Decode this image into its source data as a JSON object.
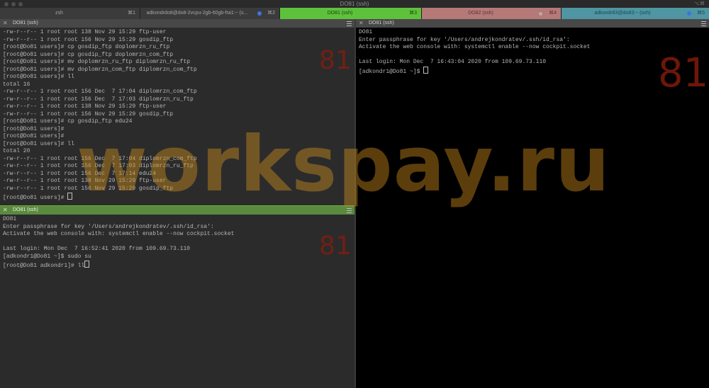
{
  "window": {
    "title": "DO81 (ssh)",
    "shortcut_hint": "⌥⌘"
  },
  "tabs": [
    {
      "label": "zsh",
      "shortcut": "⌘1",
      "color": "#3b3b3b"
    },
    {
      "label": "adkondrdo8@do8-2vcpu-2gb-60gb-fra1:~ (s...",
      "shortcut": "⌘2",
      "color": "#3b3b3b"
    },
    {
      "label": "DO81 (ssh)",
      "shortcut": "⌘3",
      "color": "#5ec13b"
    },
    {
      "label": "DO82 (ssh)",
      "shortcut": "⌘4",
      "color": "#b57a78"
    },
    {
      "label": "adkondr83@do83:~ (ssh)",
      "shortcut": "⌘5",
      "color": "#4f95a3"
    }
  ],
  "panes": {
    "top_left": {
      "title": "DO81 (ssh)",
      "number": "81",
      "lines": [
        "-rw-r--r-- 1 root root 138 Nov 29 15:29 ftp-user",
        "-rw-r--r-- 1 root root 156 Nov 29 15:29 gosdip_ftp",
        "[root@Do81 users]# cp gosdip_ftp doplomrzn_ru_ftp",
        "[root@Do81 users]# cp gosdip_ftp doplomrzn_com_ftp",
        "[root@Do81 users]# mv doplomrzn_ru_ftp diplomrzn_ru_ftp",
        "[root@Do81 users]# mv doplomrzn_com_ftp diplomrzn_com_ftp",
        "[root@Do81 users]# ll",
        "total 16",
        "-rw-r--r-- 1 root root 156 Dec  7 17:04 diplomrzn_com_ftp",
        "-rw-r--r-- 1 root root 156 Dec  7 17:03 diplomrzn_ru_ftp",
        "-rw-r--r-- 1 root root 138 Nov 29 15:29 ftp-user",
        "-rw-r--r-- 1 root root 156 Nov 29 15:29 gosdip_ftp",
        "[root@Do81 users]# cp gosdip_ftp edu24",
        "[root@Do81 users]#",
        "[root@Do81 users]#",
        "[root@Do81 users]# ll",
        "total 20",
        "-rw-r--r-- 1 root root 156 Dec  7 17:04 diplomrzn_com_ftp",
        "-rw-r--r-- 1 root root 156 Dec  7 17:03 diplomrzn_ru_ftp",
        "-rw-r--r-- 1 root root 156 Dec  7 17:14 edu24",
        "-rw-r--r-- 1 root root 138 Nov 29 15:29 ftp-user",
        "-rw-r--r-- 1 root root 156 Nov 29 15:29 gosdip_ftp"
      ],
      "prompt": "[root@Do81 users]# "
    },
    "bottom_left": {
      "title": "DO81 (ssh)",
      "number": "81",
      "lines": [
        "DO81",
        "Enter passphrase for key '/Users/andrejkondratev/.ssh/id_rsa':",
        "Activate the web console with: systemctl enable --now cockpit.socket",
        "",
        "Last login: Mon Dec  7 16:52:41 2020 from 109.69.73.110",
        "[adkondr1@Do81 ~]$ sudo su"
      ],
      "prompt": "[root@Do81 adkondr1]# ll"
    },
    "right": {
      "title": "DO81 (ssh)",
      "number": "81",
      "lines": [
        "DO81",
        "Enter passphrase for key '/Users/andrejkondratev/.ssh/id_rsa':",
        "Activate the web console with: systemctl enable --now cockpit.socket",
        "",
        "Last login: Mon Dec  7 16:43:04 2020 from 109.69.73.110"
      ],
      "prompt": "[adkondr1@Do81 ~]$ "
    }
  },
  "watermark": "workspay.ru",
  "colors": {
    "active_tab": "#5ec13b",
    "pane_header_bg": "#484848",
    "pane_header_active": "#5a8a3e",
    "terminal_bg_left": "#2b2b2b",
    "terminal_bg_right": "#000000",
    "watermark": "#c98a1c",
    "number": "#8a1c0c"
  }
}
